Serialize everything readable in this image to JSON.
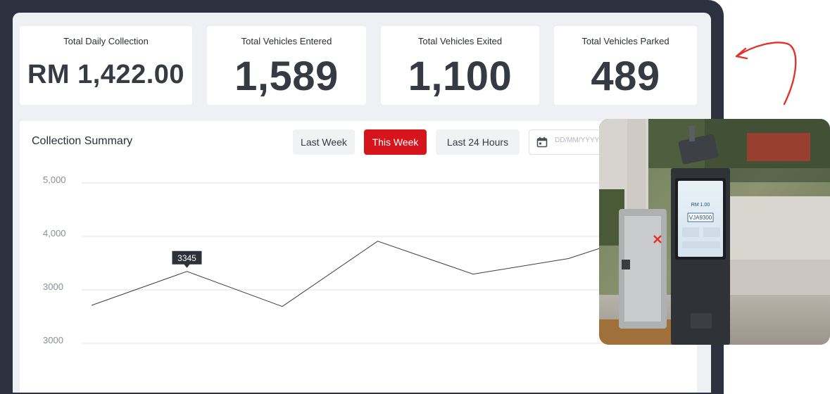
{
  "stats": [
    {
      "label": "Total Daily Collection",
      "value": "RM 1,422.00"
    },
    {
      "label": "Total Vehicles Entered",
      "value": "1,589"
    },
    {
      "label": "Total Vehicles Exited",
      "value": "1,100"
    },
    {
      "label": "Total Vehicles Parked",
      "value": "489"
    }
  ],
  "summary": {
    "title": "Collection Summary",
    "filters": [
      "Last Week",
      "This Week",
      "Last 24 Hours"
    ],
    "active_filter": "This Week",
    "date_placeholder": "DD/MM/YYYY",
    "tooltip": "3345"
  },
  "kiosk": {
    "price": "RM 1.00",
    "plate": "VJA9300"
  },
  "chart_data": {
    "type": "line",
    "y_tick_labels": [
      "5,000",
      "4,000",
      "3000",
      "3000"
    ],
    "series": [
      {
        "values": [
          2710,
          3345,
          2690,
          3910,
          3295,
          3585,
          4170
        ]
      }
    ],
    "highlight": {
      "index": 1,
      "label": "3345"
    },
    "grid": true,
    "colors": {
      "line": "#3a3d44",
      "grid": "#dcdfe3"
    }
  },
  "colors": {
    "accent": "#d6141c",
    "frame": "#2d3140",
    "background": "#eef0f4"
  }
}
